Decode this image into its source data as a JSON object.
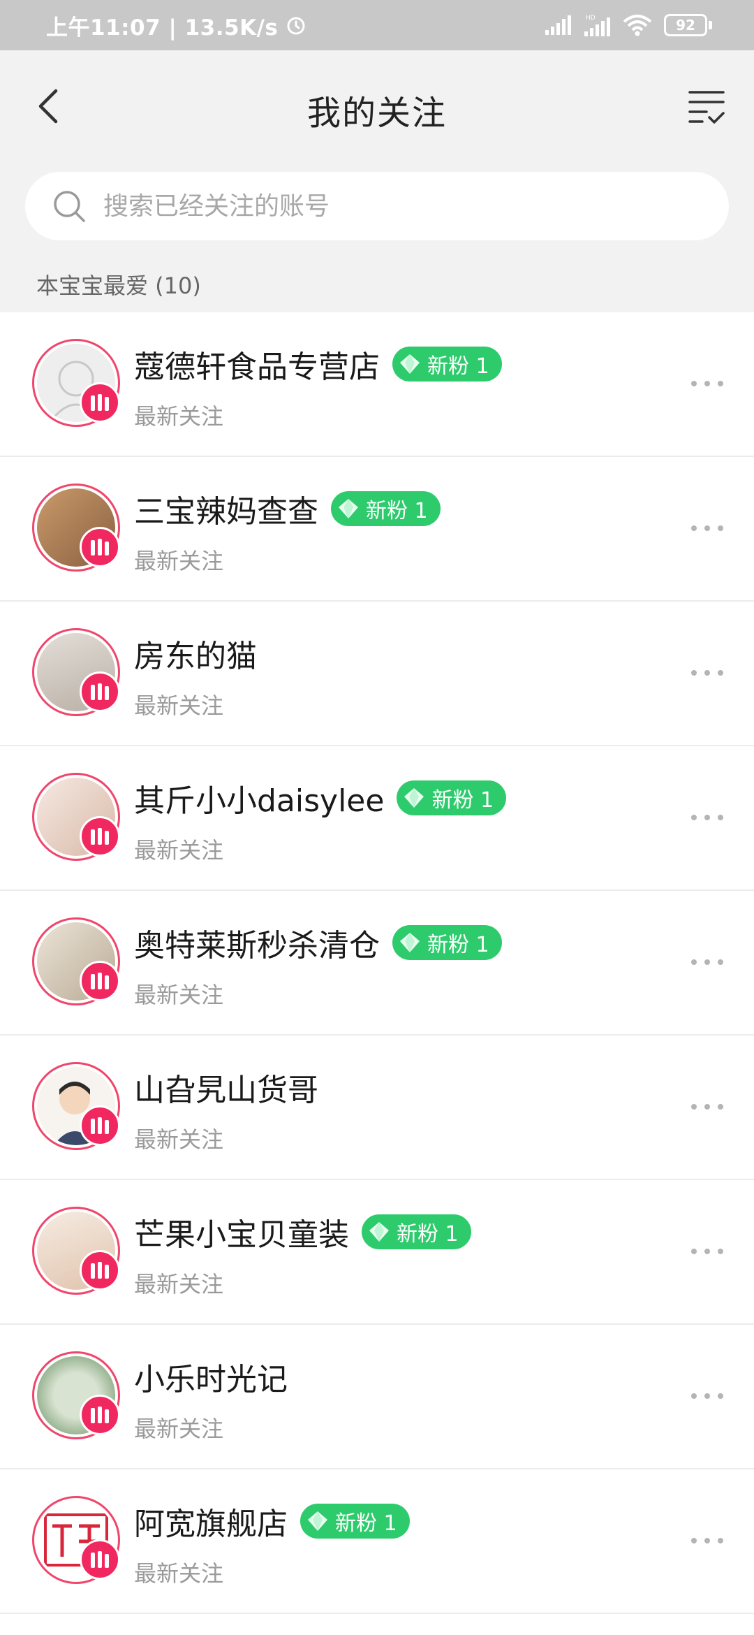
{
  "status_bar": {
    "time_text": "上午11:07 | 13.5K/s",
    "battery": "92"
  },
  "header": {
    "title": "我的关注"
  },
  "search": {
    "placeholder": "搜索已经关注的账号"
  },
  "section": {
    "label": "本宝宝最爱 (10)"
  },
  "colors": {
    "accent_pink": "#f0285f",
    "tag_green": "#2ecb6d"
  },
  "items": [
    {
      "name": "蔻德轩食品专营店",
      "tag": "新粉 1",
      "sub": "最新关注"
    },
    {
      "name": "三宝辣妈查查",
      "tag": "新粉 1",
      "sub": "最新关注"
    },
    {
      "name": "房东的猫",
      "tag": "",
      "sub": "最新关注"
    },
    {
      "name": "其斤小小daisylee",
      "tag": "新粉 1",
      "sub": "最新关注"
    },
    {
      "name": "奥特莱斯秒杀清仓",
      "tag": "新粉 1",
      "sub": "最新关注"
    },
    {
      "name": "山旮旯山货哥",
      "tag": "",
      "sub": "最新关注"
    },
    {
      "name": "芒果小宝贝童装",
      "tag": "新粉 1",
      "sub": "最新关注"
    },
    {
      "name": "小乐时光记",
      "tag": "",
      "sub": "最新关注"
    },
    {
      "name": "阿宽旗舰店",
      "tag": "新粉 1",
      "sub": "最新关注"
    }
  ]
}
